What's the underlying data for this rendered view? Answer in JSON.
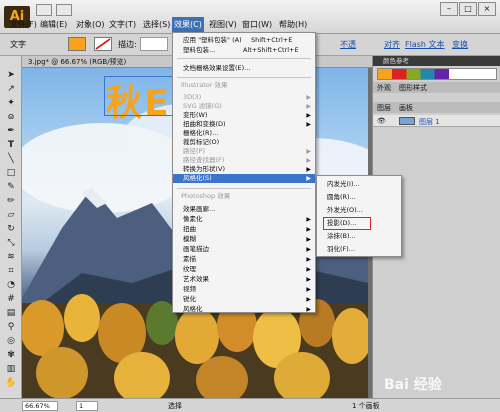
{
  "app": {
    "logo": "Ai"
  },
  "menu_bar": {
    "items": [
      {
        "label": "文件(F)"
      },
      {
        "label": "编辑(E)"
      },
      {
        "label": "对象(O)"
      },
      {
        "label": "文字(T)"
      },
      {
        "label": "选择(S)"
      },
      {
        "label": "效果(C)"
      },
      {
        "label": "视图(V)"
      },
      {
        "label": "窗口(W)"
      },
      {
        "label": "帮助(H)"
      }
    ],
    "window_buttons": [
      "–",
      "□",
      "×"
    ]
  },
  "control_bar": {
    "tool_label": "文字",
    "stroke_label": "描边:",
    "opacity_label": "不透",
    "align_label": "对齐",
    "flash_label": "Flash 文本",
    "transform_label": "变换"
  },
  "document": {
    "tab_title": "3.jpg* @ 66.67% (RGB/预览)",
    "canvas_text": "秋E"
  },
  "status_bar": {
    "zoom": "66.67%",
    "page": "1",
    "tool": "选择",
    "artboards": "1 个画板"
  },
  "panels": {
    "tabs_top": [
      "外观",
      "图形样式"
    ],
    "color_ref_label": "颜色参考",
    "tabs_layers": [
      "图层",
      "画板"
    ],
    "layer_name": "图层 1"
  },
  "effect_menu": {
    "items": [
      {
        "label": "应用 \"塑料包装\" (A)",
        "shortcut": "Shift+Ctrl+E"
      },
      {
        "label": "塑料包装...",
        "shortcut": "Alt+Shift+Ctrl+E"
      },
      {
        "label": "文档栅格效果设置(E)..."
      }
    ],
    "illustrator_header": "Illustrator 效果",
    "illustrator_items": [
      {
        "label": "3D(3)",
        "disabled": true
      },
      {
        "label": "SVG 滤镜(G)",
        "disabled": true
      },
      {
        "label": "变形(W)",
        "disabled": false
      },
      {
        "label": "扭曲和变换(D)",
        "disabled": false
      },
      {
        "label": "栅格化(R)...",
        "disabled": false
      },
      {
        "label": "裁剪标记(O)",
        "disabled": false
      },
      {
        "label": "路径(P)",
        "disabled": true
      },
      {
        "label": "路径查找器(F)",
        "disabled": true
      },
      {
        "label": "转换为形状(V)",
        "disabled": false
      },
      {
        "label": "风格化(S)",
        "disabled": false
      }
    ],
    "photoshop_header": "Photoshop 效果",
    "photoshop_items": [
      "效果画廊...",
      "像素化",
      "扭曲",
      "模糊",
      "画笔描边",
      "素描",
      "纹理",
      "艺术效果",
      "视频",
      "锐化",
      "风格化"
    ]
  },
  "stylize_submenu": {
    "items": [
      "内发光(I)...",
      "圆角(R)...",
      "外发光(O)...",
      "投影(D)...",
      "涂抹(B)...",
      "羽化(F)..."
    ],
    "highlighted_color": "#d9262c"
  },
  "watermark": {
    "text": "Bai 经验"
  },
  "colors": {
    "accent": "#3b74c8",
    "fill": "#f7a31c",
    "highlight_box": "#d9262c"
  }
}
